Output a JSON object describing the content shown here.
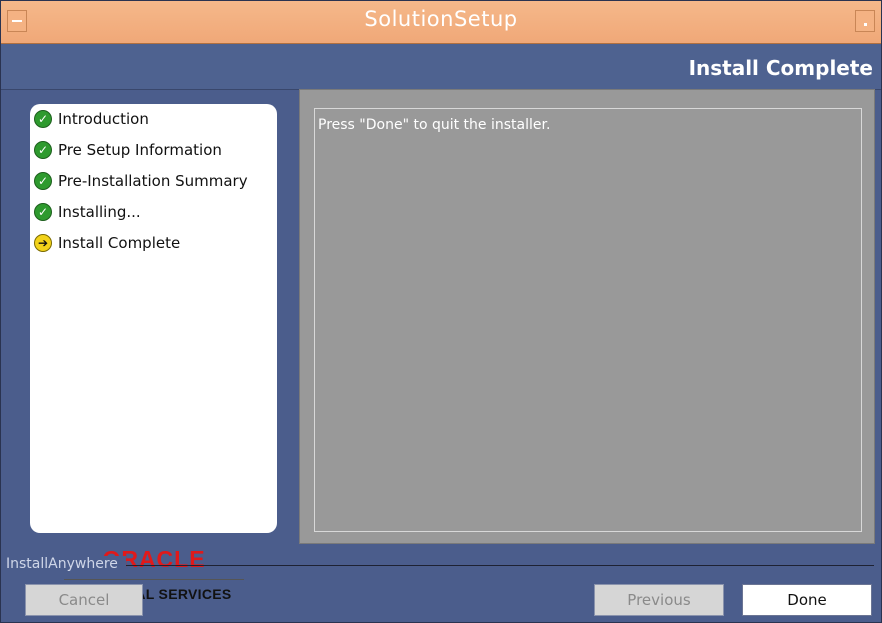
{
  "window": {
    "title": "SolutionSetup"
  },
  "header": {
    "step_title": "Install Complete"
  },
  "sidebar": {
    "steps": [
      {
        "label": "Introduction",
        "status": "done"
      },
      {
        "label": "Pre Setup Information",
        "status": "done"
      },
      {
        "label": "Pre-Installation Summary",
        "status": "done"
      },
      {
        "label": "Installing...",
        "status": "done"
      },
      {
        "label": "Install Complete",
        "status": "current"
      }
    ],
    "logo": {
      "oracle": "ORACLE",
      "financial": "FINANCIAL SERVICES"
    }
  },
  "content": {
    "message": "Press \"Done\" to quit the installer."
  },
  "footer": {
    "brand": "InstallAnywhere",
    "cancel_label": "Cancel",
    "previous_label": "Previous",
    "done_label": "Done"
  },
  "colors": {
    "accent_titlebar": "#f0a878",
    "done_status": "#2e9a2e",
    "current_status": "#f2d21a",
    "oracle_red": "#e0191a"
  }
}
